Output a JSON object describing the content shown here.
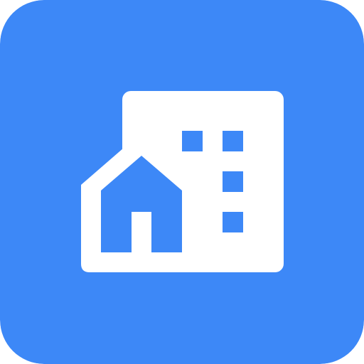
{
  "icon": {
    "name": "buildings-icon",
    "colors": {
      "background": "#3D88F7",
      "glyph": "#FFFFFF"
    }
  }
}
